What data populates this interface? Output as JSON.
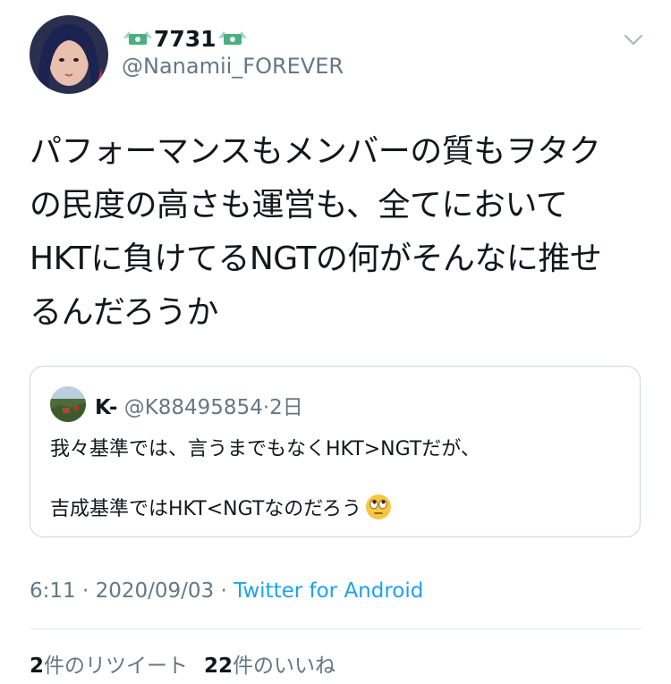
{
  "tweet": {
    "display_name_icon": "money-with-wings-icon",
    "display_name": "7731",
    "handle": "@Nanamii_FOREVER",
    "menu_icon": "chevron-down-icon",
    "text_lines": [
      "パフォーマンスもメンバーの質もヲタク",
      "の民度の高さも運営も、全てにおいて",
      "HKTに負けてるNGTの何がそんなに推せ",
      "るんだろうか"
    ],
    "time": "6:11",
    "separator": "·",
    "date": "2020/09/03",
    "source": "Twitter for Android"
  },
  "quote": {
    "name": "K-",
    "handle": "@K88495854",
    "separator": "·",
    "time": "2日",
    "line1": "我々基準では、言うまでもなくHKT>NGTだが、",
    "line2": "吉成基準ではHKT<NGTなのだろう",
    "emoji": "face-with-rolling-eyes-icon"
  },
  "stats": {
    "retweets_count": "2",
    "retweets_label": "件のリツイート",
    "likes_count": "22",
    "likes_label": "件のいいね"
  },
  "colors": {
    "text": "#14171a",
    "secondary": "#657786",
    "link": "#1da1f2",
    "border": "#ccd6dd"
  }
}
